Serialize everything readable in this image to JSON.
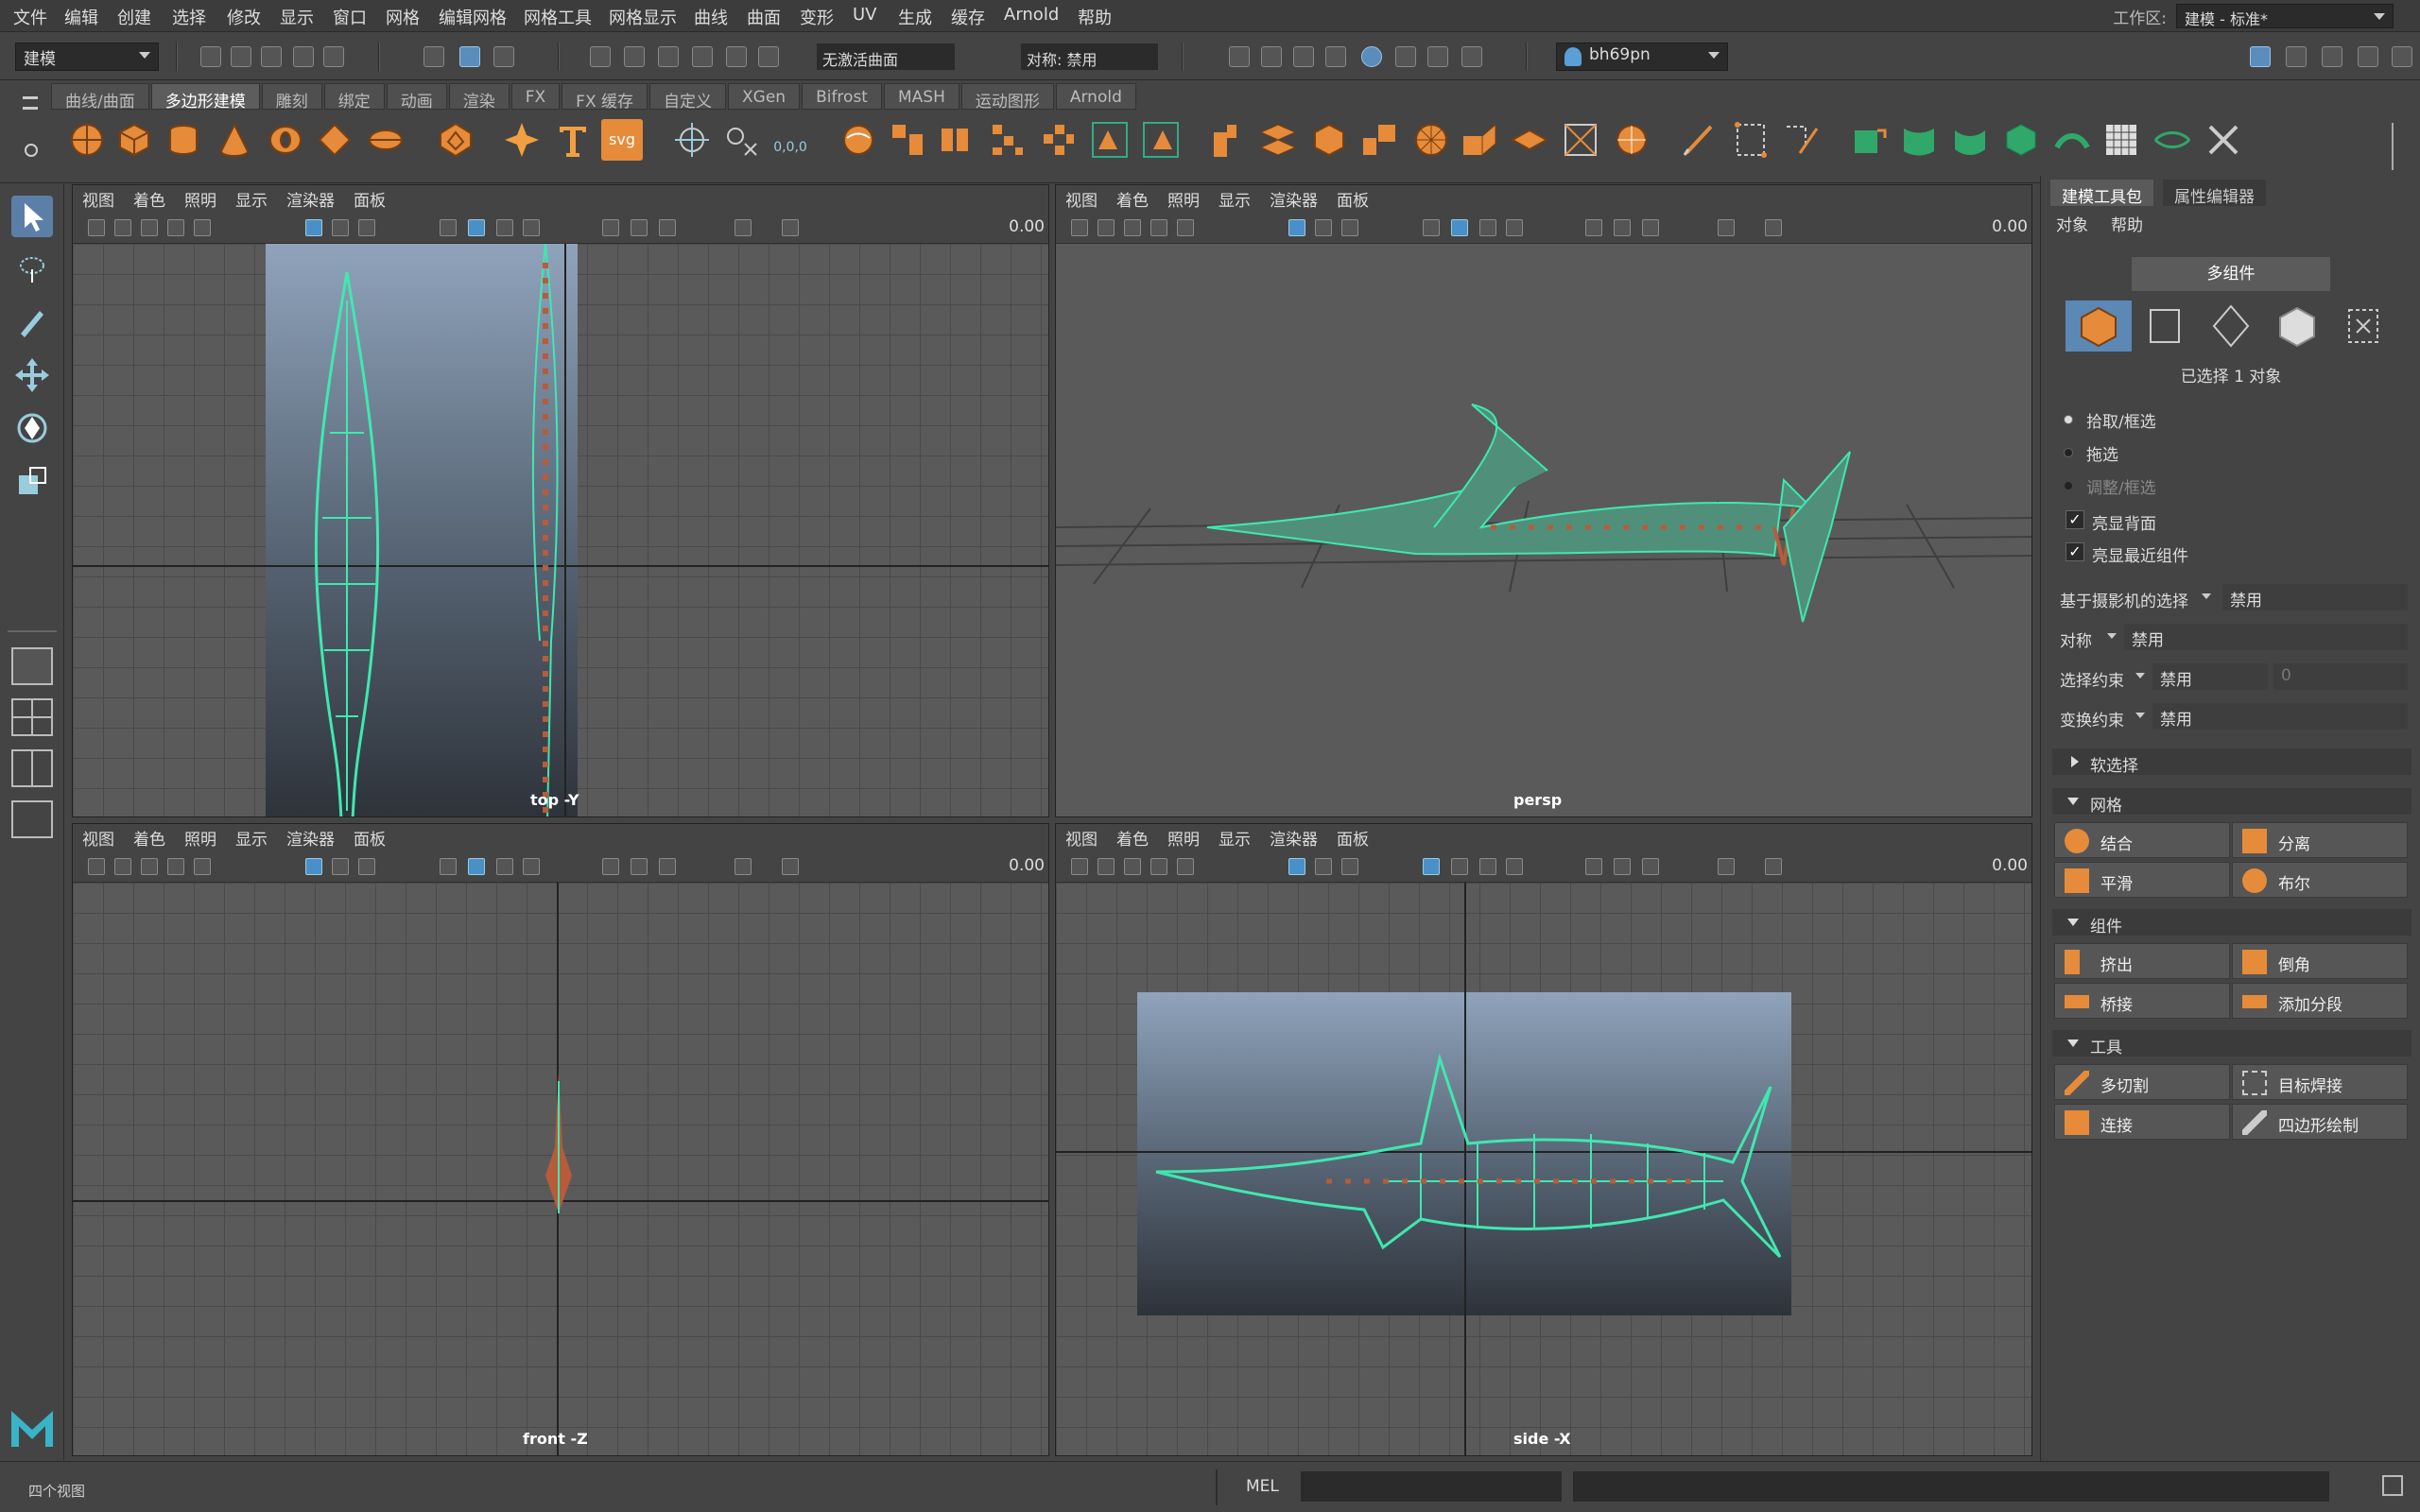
{
  "menu": [
    "文件",
    "编辑",
    "创建",
    "选择",
    "修改",
    "显示",
    "窗口",
    "网格",
    "编辑网格",
    "网格工具",
    "网格显示",
    "曲线",
    "曲面",
    "变形",
    "UV",
    "生成",
    "缓存",
    "Arnold",
    "帮助"
  ],
  "workspace": {
    "label": "工作区:",
    "value": "建模 - 标准*"
  },
  "status": {
    "mode": "建模",
    "live_surface": "无激活曲面",
    "symmetry": "对称: 禁用",
    "user": "bh69pn"
  },
  "shelf_tabs": [
    "曲线/曲面",
    "多边形建模",
    "雕刻",
    "绑定",
    "动画",
    "渲染",
    "FX",
    "FX 缓存",
    "自定义",
    "XGen",
    "Bifrost",
    "MASH",
    "运动图形",
    "Arnold"
  ],
  "shelf_svg": "svg",
  "shelf_axes": "0,0,0",
  "viewport_menu": [
    "视图",
    "着色",
    "照明",
    "显示",
    "渲染器",
    "面板"
  ],
  "viewports": [
    {
      "cam": "top -Y",
      "value": "0.00"
    },
    {
      "cam": "persp",
      "value": "0.00"
    },
    {
      "cam": "front -Z",
      "value": "0.00"
    },
    {
      "cam": "side -X",
      "value": "0.00"
    }
  ],
  "right": {
    "tabs": [
      "建模工具包",
      "属性编辑器"
    ],
    "menu": [
      "对象",
      "帮助"
    ],
    "multi": "多组件",
    "selected": "已选择 1 对象",
    "radio": [
      "拾取/框选",
      "拖选",
      "调整/框选"
    ],
    "checks": [
      "亮显背面",
      "亮显最近组件"
    ],
    "camera_sel": {
      "label": "基于摄影机的选择",
      "value": "禁用"
    },
    "symmetry": {
      "label": "对称",
      "value": "禁用"
    },
    "sel_constraint": {
      "label": "选择约束",
      "value": "禁用",
      "num": "0"
    },
    "xform_constraint": {
      "label": "变换约束",
      "value": "禁用"
    },
    "soft": "软选择",
    "mesh": {
      "title": "网格",
      "btns": [
        "结合",
        "分离",
        "平滑",
        "布尔"
      ]
    },
    "comp": {
      "title": "组件",
      "btns": [
        "挤出",
        "倒角",
        "桥接",
        "添加分段"
      ]
    },
    "tools": {
      "title": "工具",
      "btns": [
        "多切割",
        "目标焊接",
        "连接",
        "四边形绘制"
      ]
    }
  },
  "bottom": {
    "help": "四个视图",
    "lang": "MEL"
  }
}
